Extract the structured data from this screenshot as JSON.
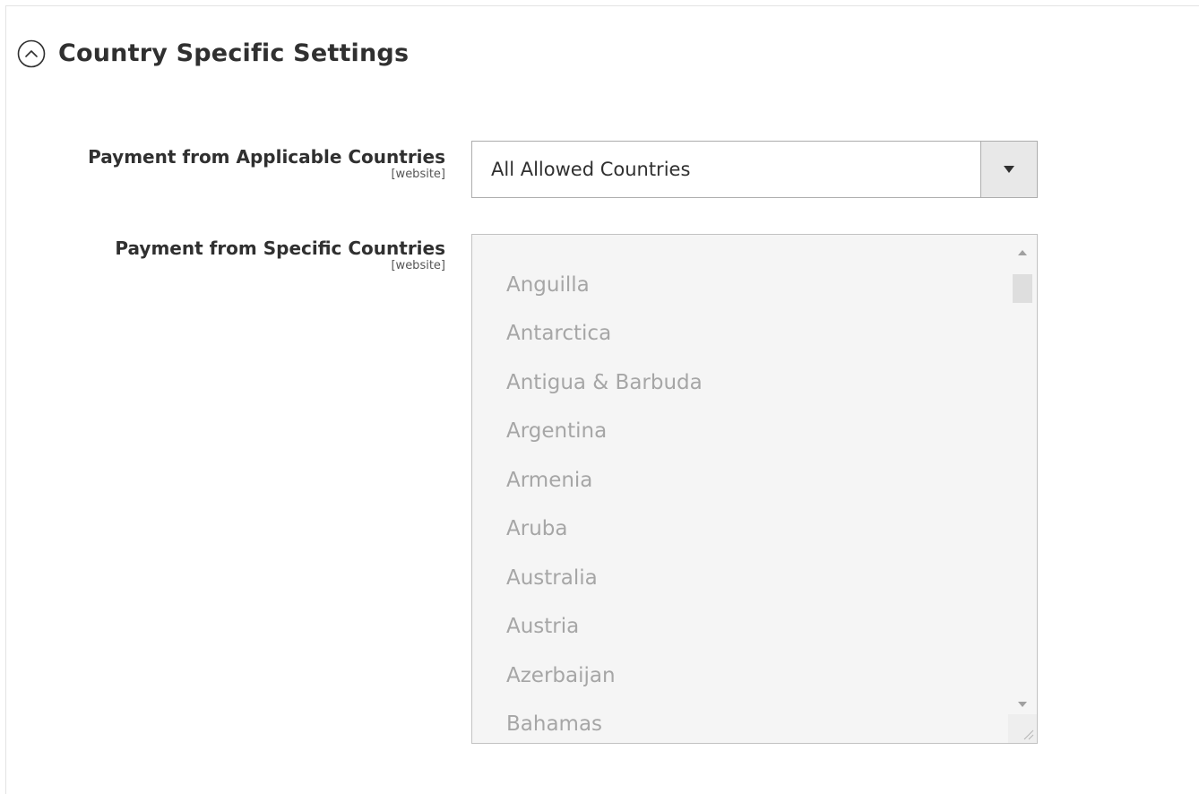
{
  "section": {
    "title": "Country Specific Settings",
    "icon": "chevron-up-circle-icon"
  },
  "applicable_countries": {
    "label": "Payment from Applicable Countries",
    "scope": "[website]",
    "selected": "All Allowed Countries"
  },
  "specific_countries": {
    "label": "Payment from Specific Countries",
    "scope": "[website]",
    "disabled": true,
    "options": [
      "Anguilla",
      "Antarctica",
      "Antigua & Barbuda",
      "Argentina",
      "Armenia",
      "Aruba",
      "Australia",
      "Austria",
      "Azerbaijan",
      "Bahamas"
    ]
  },
  "colors": {
    "title_text": "#303030",
    "disabled_text": "#a6a6a6",
    "disabled_bg": "#f5f5f5",
    "border": "#adadad"
  }
}
